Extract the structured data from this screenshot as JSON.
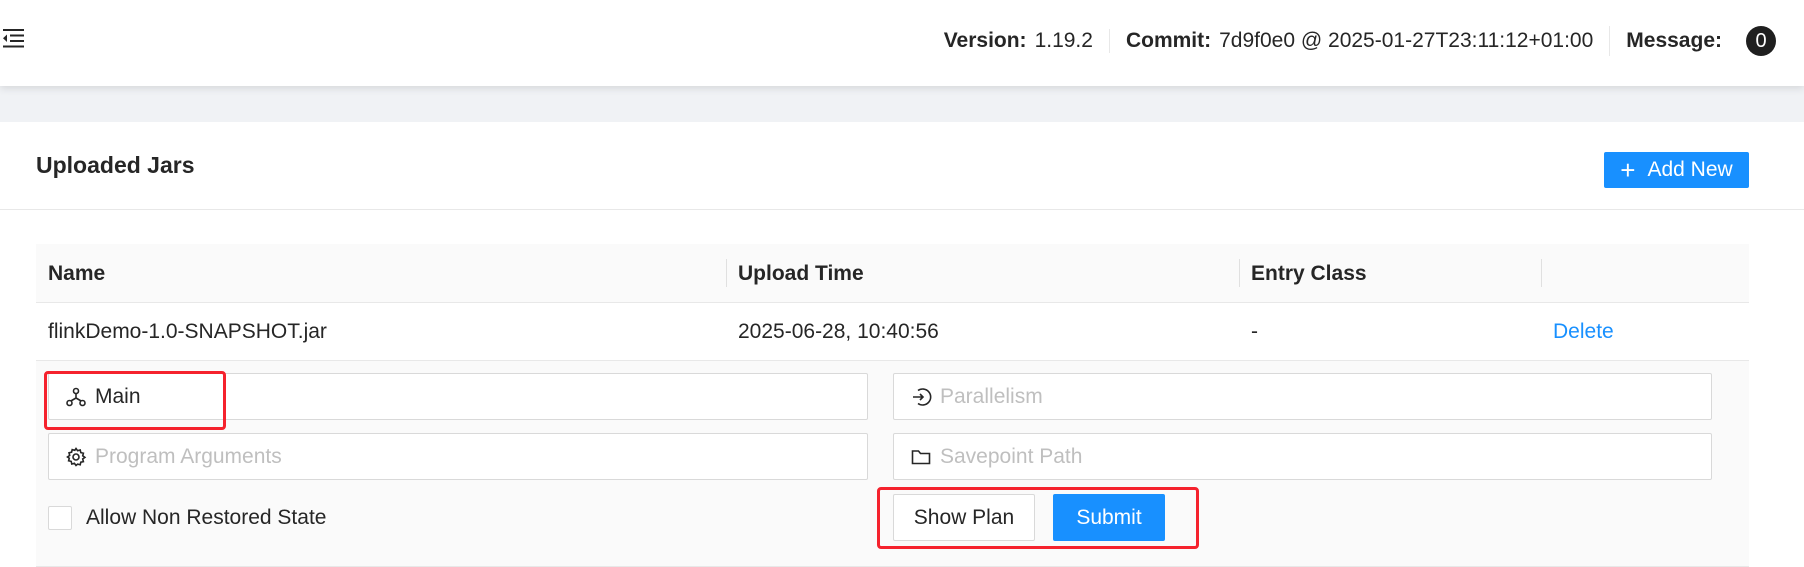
{
  "header": {
    "menu_icon": "menu-fold-icon",
    "version_label": "Version:",
    "version_value": "1.19.2",
    "commit_label": "Commit:",
    "commit_value": "7d9f0e0 @ 2025-01-27T23:11:12+01:00",
    "message_label": "Message:",
    "message_count": "0"
  },
  "card": {
    "title": "Uploaded Jars",
    "add_button_label": "Add New",
    "add_button_icon": "plus-icon"
  },
  "table": {
    "columns": [
      "Name",
      "Upload Time",
      "Entry Class",
      ""
    ],
    "rows": [
      {
        "name": "flinkDemo-1.0-SNAPSHOT.jar",
        "upload_time": "2025-06-28, 10:40:56",
        "entry_class": "-",
        "action": "Delete"
      }
    ]
  },
  "submit_form": {
    "entry_class_value": "Main",
    "entry_class_icon": "cluster-icon",
    "parallelism_placeholder": "Parallelism",
    "parallelism_icon": "login-arrow-icon",
    "program_args_placeholder": "Program Arguments",
    "program_args_icon": "gear-icon",
    "savepoint_placeholder": "Savepoint Path",
    "savepoint_icon": "folder-icon",
    "allow_non_restored_label": "Allow Non Restored State",
    "show_plan_label": "Show Plan",
    "submit_label": "Submit"
  },
  "colors": {
    "primary": "#1890ff",
    "highlight": "#f5222d",
    "badge": "#1f1f1f"
  }
}
